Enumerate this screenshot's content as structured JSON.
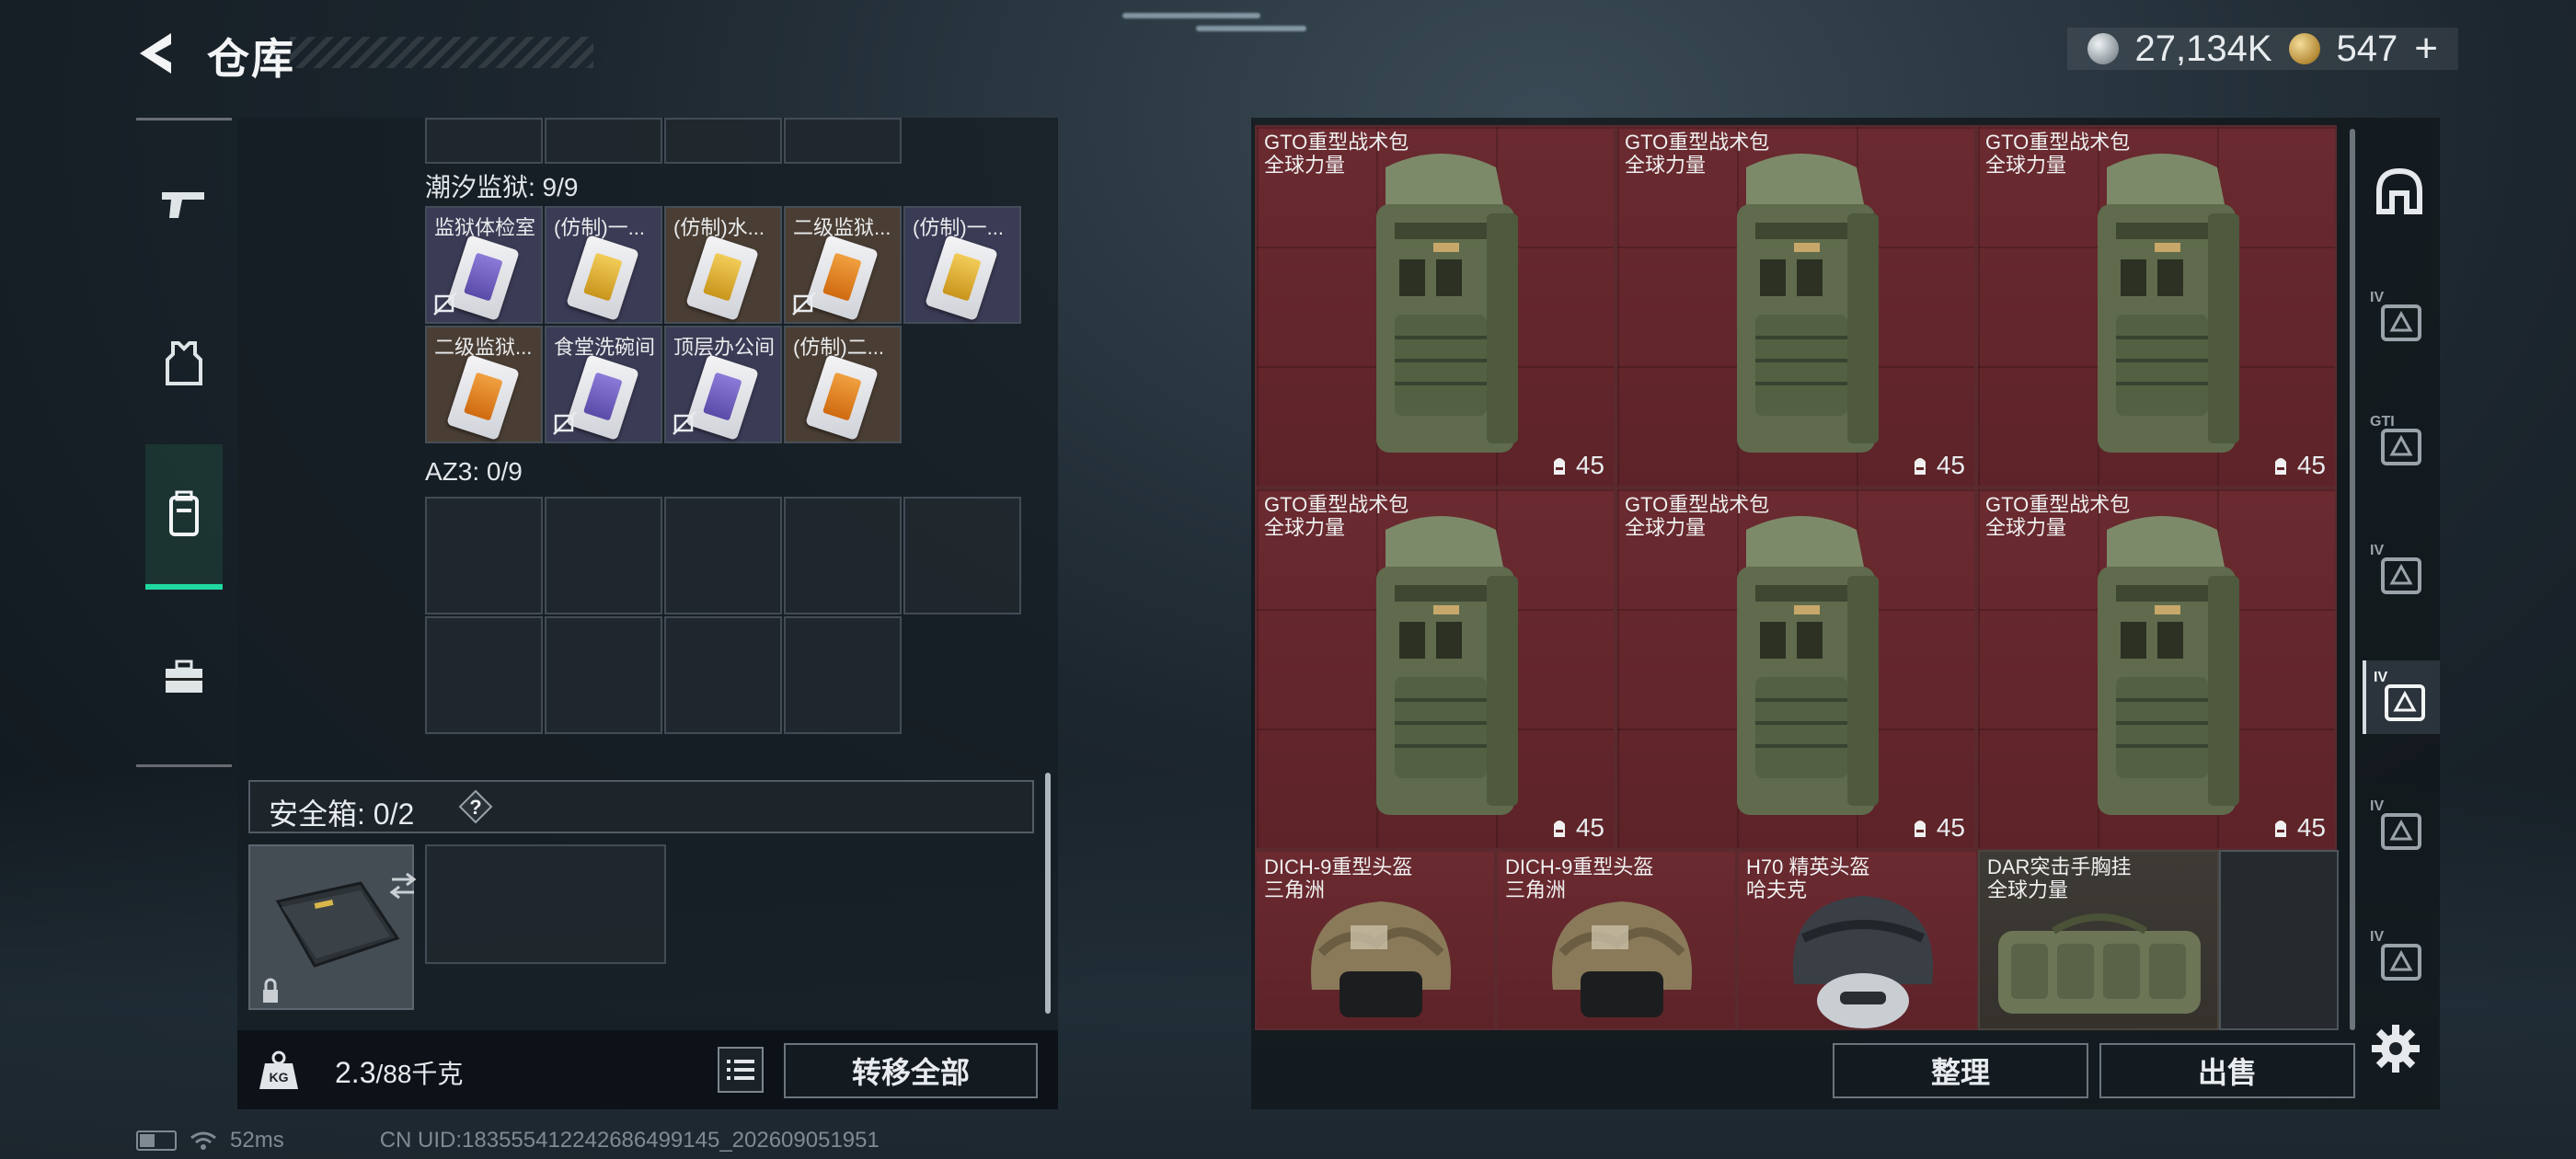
{
  "header": {
    "title": "仓库",
    "silver_amount": "27,134K",
    "gold_amount": "547",
    "gold_plus": "+"
  },
  "stash": {
    "section1_title": "潮汐监狱: 9/9",
    "section1_cards": [
      {
        "name": "监狱体检室",
        "color": "purple",
        "cell": "purple",
        "no_key": true
      },
      {
        "name": "(仿制)一...",
        "color": "gold",
        "cell": "purple",
        "no_key": false
      },
      {
        "name": "(仿制)水...",
        "color": "gold",
        "cell": "brown",
        "no_key": false
      },
      {
        "name": "二级监狱...",
        "color": "orange",
        "cell": "brown",
        "no_key": true
      },
      {
        "name": "(仿制)一...",
        "color": "gold",
        "cell": "purple",
        "no_key": false
      },
      {
        "name": "二级监狱...",
        "color": "orange",
        "cell": "brown",
        "no_key": false
      },
      {
        "name": "食堂洗碗间",
        "color": "purple",
        "cell": "purple",
        "no_key": true
      },
      {
        "name": "顶层办公间",
        "color": "purple",
        "cell": "purple",
        "no_key": true
      },
      {
        "name": "(仿制)二...",
        "color": "orange",
        "cell": "brown",
        "no_key": false
      }
    ],
    "section2_title": "AZ3: 0/9",
    "safebox_label": "安全箱: 0/2",
    "safebox_help": "?",
    "weight_value": "2.3",
    "weight_max": "/88千克",
    "transfer_all": "转移全部",
    "kg_label": "KG"
  },
  "inventory": {
    "bags": [
      {
        "name": "GTO重型战术包",
        "sub": "全球力量",
        "count": "45"
      },
      {
        "name": "GTO重型战术包",
        "sub": "全球力量",
        "count": "45"
      },
      {
        "name": "GTO重型战术包",
        "sub": "全球力量",
        "count": "45"
      },
      {
        "name": "GTO重型战术包",
        "sub": "全球力量",
        "count": "45"
      },
      {
        "name": "GTO重型战术包",
        "sub": "全球力量",
        "count": "45"
      },
      {
        "name": "GTO重型战术包",
        "sub": "全球力量",
        "count": "45"
      }
    ],
    "bottom_items": [
      {
        "name": "DICH-9重型头盔",
        "sub": "三角洲"
      },
      {
        "name": "DICH-9重型头盔",
        "sub": "三角洲"
      },
      {
        "name": "H70 精英头盔",
        "sub": "哈夫克"
      },
      {
        "name": "DAR突击手胸挂",
        "sub": "全球力量"
      }
    ],
    "sort_label": "整理",
    "sell_label": "出售"
  },
  "right_nav": [
    "",
    "IV",
    "GTI",
    "IV",
    "IV",
    "IV",
    "IV"
  ],
  "status": {
    "ping": "52ms",
    "uid": "CN UID:183555412242686499145_202609051951"
  },
  "colors": {
    "accent": "#1fd9a0",
    "item_red": "#6a2a30",
    "purple_cell": "#3a3b55",
    "brown_cell": "#4a3e34"
  }
}
